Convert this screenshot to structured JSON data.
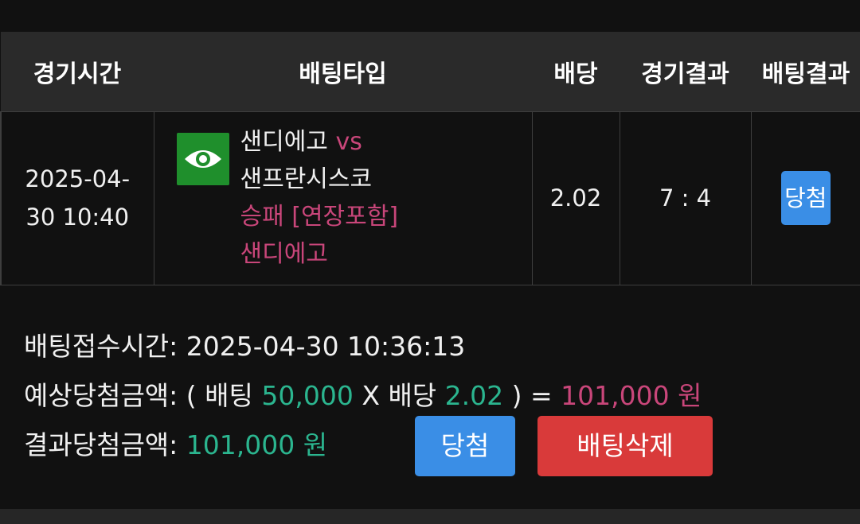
{
  "table": {
    "headers": {
      "time": "경기시간",
      "bet_type": "배팅타입",
      "odds": "배당",
      "game_result": "경기결과",
      "bet_result": "배팅결과"
    },
    "row": {
      "time_date": "2025-04-",
      "time_rest": "30 10:40",
      "home_team": "샌디에고",
      "vs": "vs",
      "away_team": "샌프란시스코",
      "market": "승패 [연장포함]",
      "pick": "샌디에고",
      "odds": "2.02",
      "score": "7 : 4",
      "result_badge": "당첨"
    }
  },
  "info": {
    "accepted_label": "배팅접수시간:",
    "accepted_value": "2025-04-30 10:36:13",
    "expected_label": "예상당첨금액:",
    "expected_open": "( 배팅",
    "expected_stake": "50,000",
    "expected_mult": "X 배당",
    "expected_odds": "2.02",
    "expected_close": ") =",
    "expected_amount": "101,000 원",
    "result_label": "결과당첨금액:",
    "result_amount": "101,000 원"
  },
  "buttons": {
    "win": "당첨",
    "delete": "배팅삭제"
  },
  "icons": {
    "view": "eye-icon"
  },
  "colors": {
    "header_bg": "#2a2a2a",
    "accent_pink": "#c9467a",
    "accent_green": "#2bb58f",
    "win_blue": "#3a8ee6",
    "delete_red": "#d93a3a",
    "eye_green": "#1f8f2c"
  }
}
